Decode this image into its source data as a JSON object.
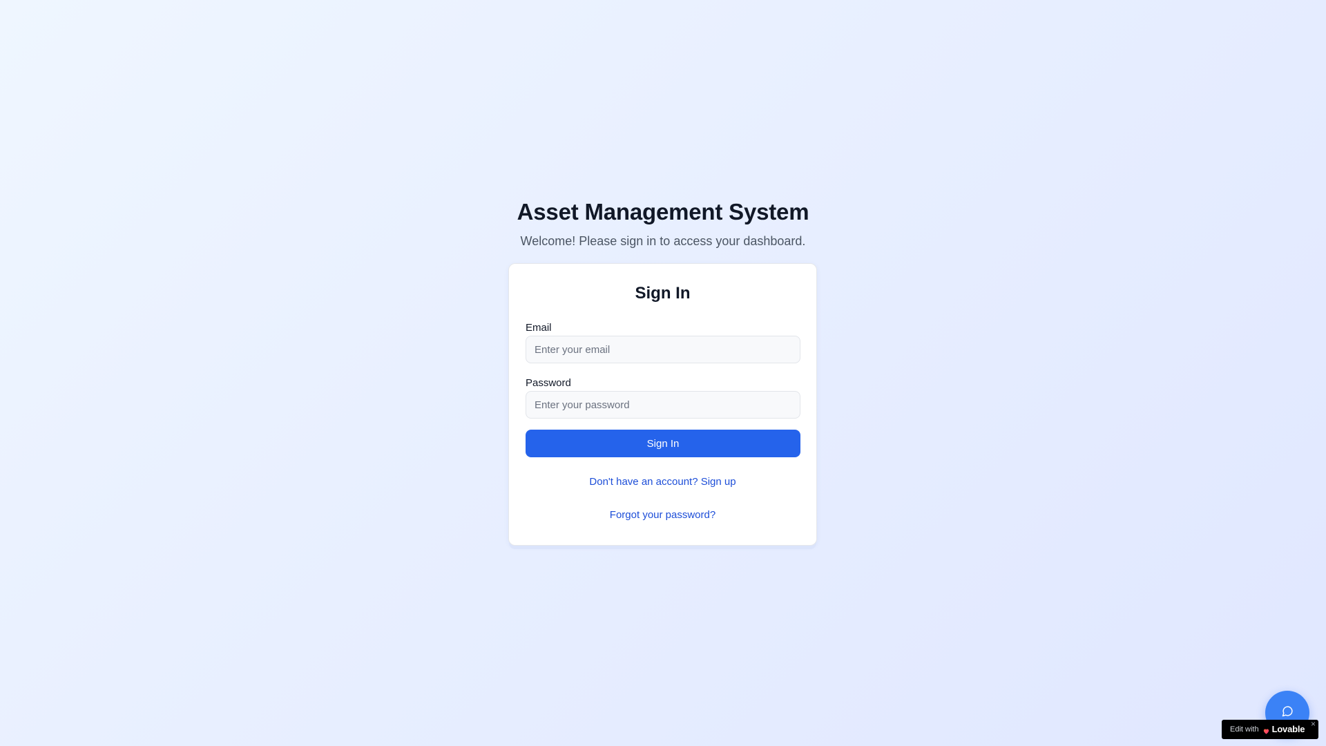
{
  "header": {
    "title": "Asset Management System",
    "subtitle": "Welcome! Please sign in to access your dashboard."
  },
  "signin_card": {
    "title": "Sign In",
    "email": {
      "label": "Email",
      "value": "",
      "placeholder": "Enter your email"
    },
    "password": {
      "label": "Password",
      "value": "",
      "placeholder": "Enter your password"
    },
    "submit_label": "Sign In",
    "signup_link": "Don't have an account? Sign up",
    "forgot_link": "Forgot your password?"
  },
  "chat_button": {
    "icon": "chat-bubble-icon"
  },
  "lovable_badge": {
    "prefix": "Edit with",
    "brand": "Lovable",
    "close": "×"
  },
  "colors": {
    "accent": "#2563eb",
    "link": "#1d4ed8",
    "fab": "#3b82f6",
    "background_start": "#eff6ff",
    "background_end": "#e0e7ff"
  }
}
